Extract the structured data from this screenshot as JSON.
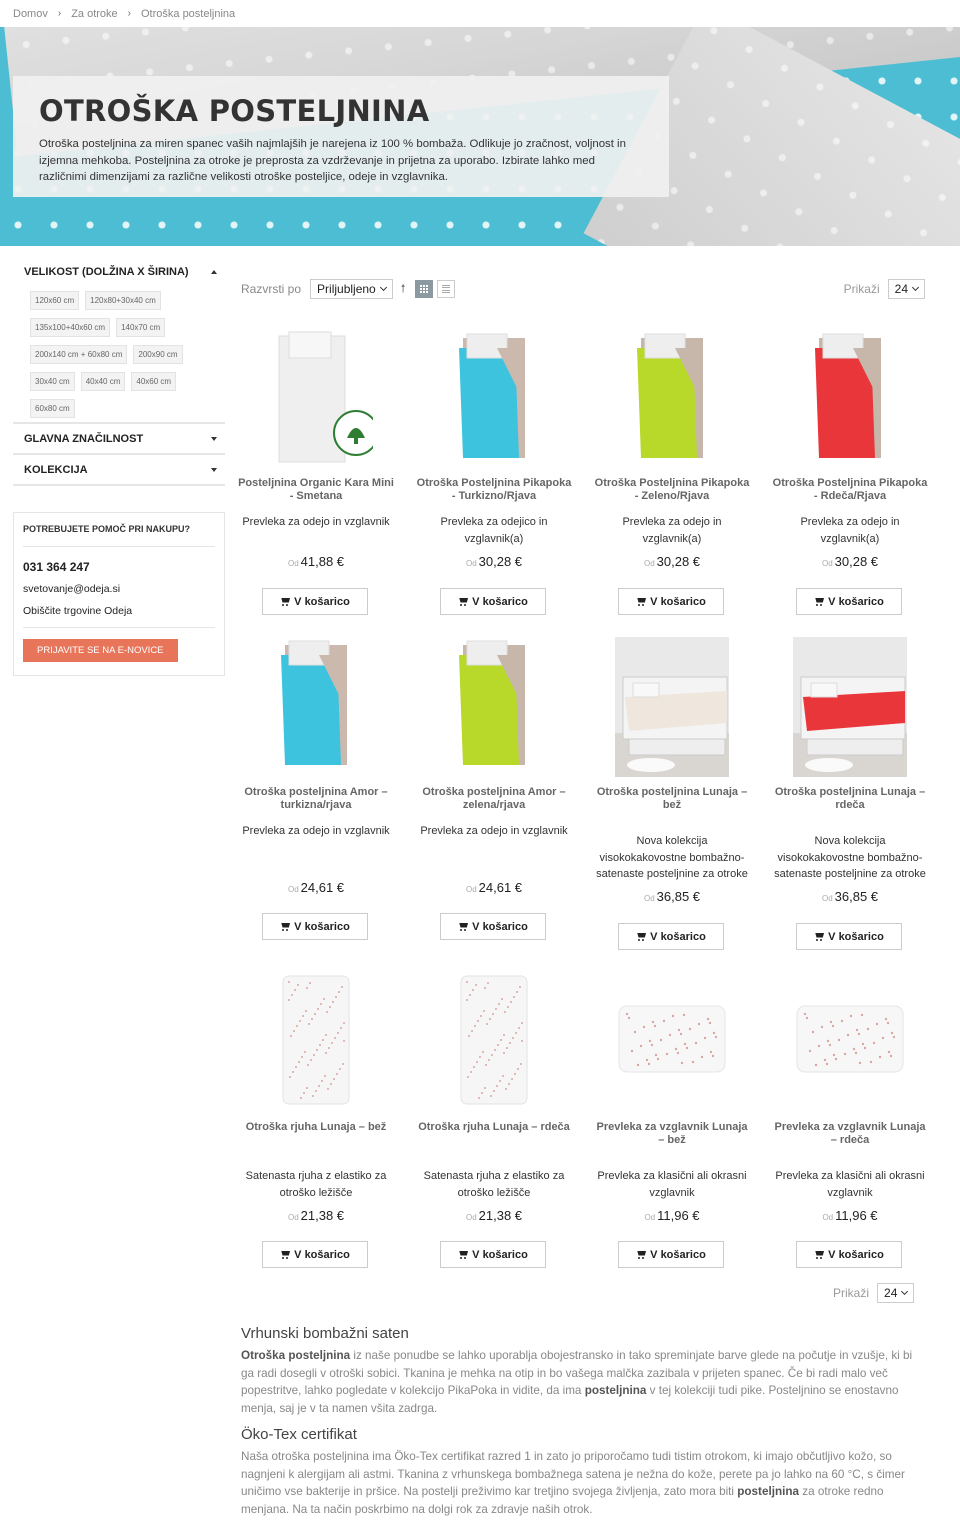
{
  "breadcrumb": [
    "Domov",
    "Za otroke",
    "Otroška posteljnina"
  ],
  "hero": {
    "title": "OTROŠKA POSTELJNINA",
    "text": "Otroška posteljnina za miren spanec vaših najmlajših je narejena iz 100 % bombaža. Odlikuje jo zračnost, voljnost in izjemna mehkoba. Posteljnina za otroke je preprosta za vzdrževanje in prijetna za uporabo. Izbirate lahko med različnimi dimenzijami za različne velikosti otroške posteljice, odeje in vzglavnika."
  },
  "filters": {
    "size_title": "VELIKOST (DOLŽINA X ŠIRINA)",
    "sizes": [
      "120x60 cm",
      "120x80+30x40 cm",
      "135x100+40x60 cm",
      "140x70 cm",
      "200x140 cm + 60x80 cm",
      "200x90 cm",
      "30x40 cm",
      "40x40 cm",
      "40x60 cm",
      "60x80 cm"
    ],
    "feature_title": "GLAVNA ZNAČILNOST",
    "collection_title": "KOLEKCIJA"
  },
  "help": {
    "title": "POTREBUJETE POMOČ PRI NAKUPU?",
    "phone": "031 364 247",
    "email": "svetovanje@odeja.si",
    "stores": "Obiščite trgovine Odeja",
    "newsletter": "PRIJAVITE SE NA E-NOVICE"
  },
  "toolbar": {
    "sort_label": "Razvrsti po",
    "sort_value": "Priljubljeno",
    "show_label": "Prikaži",
    "show_value": "24"
  },
  "colors": {
    "accent": "#e8755a",
    "hero_bg": "#4dbdd3"
  },
  "cart_label": "V košarico",
  "price_prefix": "Od",
  "products": [
    {
      "name": "Posteljnina Organic Kara Mini - Smetana",
      "desc": "Prevleka za odejo in vzglavnik",
      "price": "41,88 €",
      "image": "white-organic-duvet"
    },
    {
      "name": "Otroška Posteljnina Pikapoka - Turkizno/Rjava",
      "desc": "Prevleka za odejico in vzglavnik(a)",
      "price": "30,28 €",
      "image": "turquoise-duvet"
    },
    {
      "name": "Otroška Posteljnina Pikapoka - Zeleno/Rjava",
      "desc": "Prevleka za odejo in vzglavnik(a)",
      "price": "30,28 €",
      "image": "lime-duvet"
    },
    {
      "name": "Otroška Posteljnina Pikapoka - Rdeča/Rjava",
      "desc": "Prevleka za odejo in vzglavnik(a)",
      "price": "30,28 €",
      "image": "red-duvet"
    },
    {
      "name": "Otroška posteljnina Amor – turkizna/rjava",
      "desc": "Prevleka za odejo in vzglavnik",
      "price": "24,61 €",
      "image": "turquoise-duvet"
    },
    {
      "name": "Otroška posteljnina Amor – zelena/rjava",
      "desc": "Prevleka za odejo in vzglavnik",
      "price": "24,61 €",
      "image": "lime-duvet"
    },
    {
      "name": "Otroška posteljnina Lunaja – bež",
      "desc": "Nova kolekcija visokokakovostne bombažno-satenaste posteljnine za otroke",
      "price": "36,85 €",
      "image": "bedroom-beige"
    },
    {
      "name": "Otroška posteljnina Lunaja – rdeča",
      "desc": "Nova kolekcija visokokakovostne bombažno-satenaste posteljnine za otroke",
      "price": "36,85 €",
      "image": "bedroom-red"
    },
    {
      "name": "Otroška rjuha Lunaja – bež",
      "desc": "Satenasta rjuha z elastiko za otroško ležišče",
      "price": "21,38 €",
      "image": "fitted-sheet"
    },
    {
      "name": "Otroška rjuha Lunaja – rdeča",
      "desc": "Satenasta rjuha z elastiko za otroško ležišče",
      "price": "21,38 €",
      "image": "fitted-sheet"
    },
    {
      "name": "Prevleka za vzglavnik Lunaja – bež",
      "desc": "Prevleka za klasični ali okrasni vzglavnik",
      "price": "11,96 €",
      "image": "pillowcase"
    },
    {
      "name": "Prevleka za vzglavnik Lunaja – rdeča",
      "desc": "Prevleka za klasični ali okrasni vzglavnik",
      "price": "11,96 €",
      "image": "pillowcase"
    }
  ],
  "seo": {
    "h1": "Vrhunski bombažni saten",
    "p1_a": "Otroška posteljnina",
    "p1_b": " iz naše ponudbe se lahko uporablja obojestransko in tako spreminjate barve glede na počutje in vzušje, ki bi ga radi dosegli v otroški sobici. Tkanina je mehka na otip in bo vašega malčka zazibala v prijeten spanec. Če bi radi malo več popestritve, lahko pogledate v kolekcijo PikaPoka in vidite, da ima ",
    "p1_c": "posteljnina",
    "p1_d": " v tej kolekciji tudi pike. Posteljnino se enostavno menja, saj je v ta namen všita zadrga.",
    "h2": "Öko-Tex certifikat",
    "p2_a": "Naša otroška posteljnina ima Öko-Tex certifikat razred 1 in zato jo priporočamo tudi tistim otrokom, ki imajo občutljivo kožo, so nagnjeni k alergijam ali astmi. Tkanina z vrhunskega bombažnega satena je nežna do kože, perete pa jo lahko na 60 °C, s čimer uničimo vse bakterije in pršice. Na postelji preživimo kar tretjino svojega življenja, zato mora biti ",
    "p2_b": "posteljnina",
    "p2_c": " za otroke redno menjana. Na ta način poskrbimo na dolgi rok za zdravje naših otrok."
  }
}
